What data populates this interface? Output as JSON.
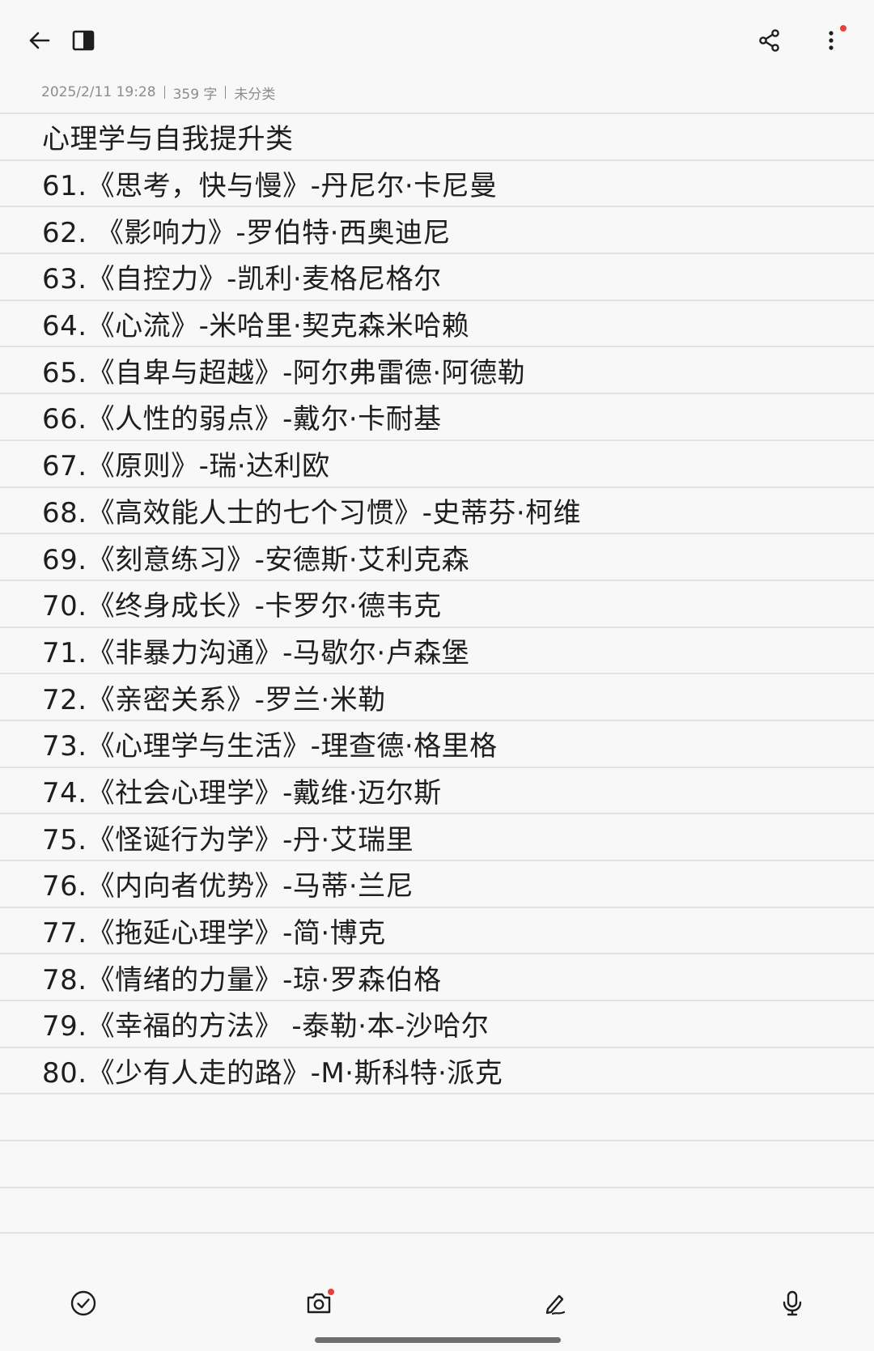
{
  "header": {
    "back_icon": "arrow-left-icon",
    "panel_icon": "sidebar-toggle-icon",
    "share_icon": "share-icon",
    "more_icon": "more-vertical-icon",
    "notification_dot_color": "#e8413a"
  },
  "meta": {
    "date": "2025/2/11 19:28",
    "word_count": "359 字",
    "category": "未分类"
  },
  "note": {
    "title": "心理学与自我提升类",
    "items": [
      "61.《思考，快与慢》-丹尼尔·卡尼曼",
      "62. 《影响力》-罗伯特·西奥迪尼",
      "63.《自控力》-凯利·麦格尼格尔",
      "64.《心流》-米哈里·契克森米哈赖",
      "65.《自卑与超越》-阿尔弗雷德·阿德勒",
      "66.《人性的弱点》-戴尔·卡耐基",
      "67.《原则》-瑞·达利欧",
      "68.《高效能人士的七个习惯》-史蒂芬·柯维",
      "69.《刻意练习》-安德斯·艾利克森",
      "70.《终身成长》-卡罗尔·德韦克",
      "71.《非暴力沟通》-马歇尔·卢森堡",
      "72.《亲密关系》-罗兰·米勒",
      "73.《心理学与生活》-理查德·格里格",
      "74.《社会心理学》-戴维·迈尔斯",
      "75.《怪诞行为学》-丹·艾瑞里",
      "76.《内向者优势》-马蒂·兰尼",
      "77.《拖延心理学》-简·博克",
      "78.《情绪的力量》-琼·罗森伯格",
      "79.《幸福的方法》 -泰勒·本-沙哈尔",
      "80.《少有人走的路》-M·斯科特·派克"
    ]
  },
  "toolbar": {
    "checklist_icon": "check-circle-icon",
    "camera_icon": "camera-icon",
    "draw_icon": "pen-icon",
    "voice_icon": "microphone-icon"
  }
}
